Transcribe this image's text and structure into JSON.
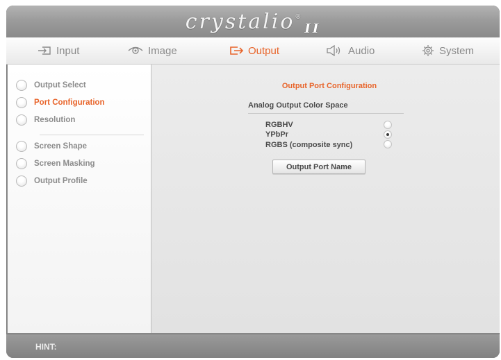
{
  "app": {
    "logo_text": "crystalio",
    "logo_reg": "®",
    "logo_suffix": "II"
  },
  "tabs": [
    {
      "label": "Input",
      "icon": "input-arrow-icon",
      "active": false
    },
    {
      "label": "Image",
      "icon": "eye-icon",
      "active": false
    },
    {
      "label": "Output",
      "icon": "output-arrow-icon",
      "active": true
    },
    {
      "label": "Audio",
      "icon": "speaker-icon",
      "active": false
    },
    {
      "label": "System",
      "icon": "gear-icon",
      "active": false
    }
  ],
  "sidebar": {
    "items": [
      {
        "label": "Output Select",
        "active": false
      },
      {
        "label": "Port Configuration",
        "active": true
      },
      {
        "label": "Resolution",
        "active": false
      },
      {
        "label": "Screen Shape",
        "active": false
      },
      {
        "label": "Screen Masking",
        "active": false
      },
      {
        "label": "Output Profile",
        "active": false
      }
    ]
  },
  "content": {
    "title": "Output Port Configuration",
    "color_space": {
      "label": "Analog Output Color Space",
      "options": [
        {
          "label": "RGBHV",
          "selected": false
        },
        {
          "label": "YPbPr",
          "selected": true
        },
        {
          "label": "RGBS (composite sync)",
          "selected": false
        }
      ]
    },
    "port_name_button": "Output Port Name"
  },
  "hint": {
    "label": "HINT:"
  },
  "colors": {
    "accent": "#e8642a",
    "text_gray": "#8c8c8c",
    "dark_text": "#4a4a4a"
  }
}
